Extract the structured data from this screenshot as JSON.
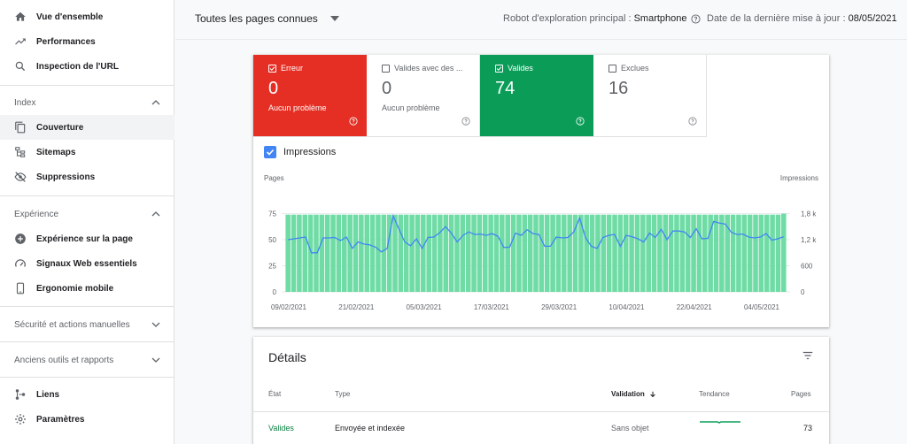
{
  "sidebar": {
    "items_top": [
      {
        "label": "Vue d'ensemble",
        "icon": "home-icon"
      },
      {
        "label": "Performances",
        "icon": "trending-up-icon"
      },
      {
        "label": "Inspection de l'URL",
        "icon": "search-icon"
      }
    ],
    "index_section": {
      "title": "Index",
      "items": [
        {
          "label": "Couverture",
          "icon": "copy-icon",
          "active": true
        },
        {
          "label": "Sitemaps",
          "icon": "sitemap-icon"
        },
        {
          "label": "Suppressions",
          "icon": "eye-off-icon"
        }
      ]
    },
    "experience_section": {
      "title": "Expérience",
      "items": [
        {
          "label": "Expérience sur la page",
          "icon": "add-circle-icon"
        },
        {
          "label": "Signaux Web essentiels",
          "icon": "speed-icon"
        },
        {
          "label": "Ergonomie mobile",
          "icon": "phone-icon"
        }
      ]
    },
    "security_section": {
      "title": "Sécurité et actions manuelles"
    },
    "legacy_section": {
      "title": "Anciens outils et rapports"
    },
    "items_bottom": [
      {
        "label": "Liens",
        "icon": "links-icon"
      },
      {
        "label": "Paramètres",
        "icon": "gear-icon"
      }
    ]
  },
  "topbar": {
    "page_select": "Toutes les pages connues",
    "robot_label": "Robot d'exploration principal :",
    "robot_value": "Smartphone",
    "last_update_label": "Date de la dernière mise à jour :",
    "last_update_value": "08/05/2021"
  },
  "summary": {
    "tiles": [
      {
        "label": "Erreur",
        "value": "0",
        "sub": "Aucun problème",
        "checked": true,
        "color": "#e52f24"
      },
      {
        "label": "Valides avec des ...",
        "value": "0",
        "sub": "Aucun problème",
        "checked": false,
        "color": "#ffffff"
      },
      {
        "label": "Valides",
        "value": "74",
        "sub": "",
        "checked": true,
        "color": "#0b9d58"
      },
      {
        "label": "Exclues",
        "value": "16",
        "sub": "",
        "checked": false,
        "color": "#ffffff"
      }
    ],
    "impressions_label": "Impressions"
  },
  "chart_data": {
    "type": "bar",
    "left_axis_label": "Pages",
    "right_axis_label": "Impressions",
    "left_ticks": [
      "0",
      "25",
      "50",
      "75"
    ],
    "right_ticks": [
      "0",
      "600",
      "1,2 k",
      "1,8 k"
    ],
    "x_tick_labels": [
      "09/02/2021",
      "21/02/2021",
      "05/03/2021",
      "17/03/2021",
      "29/03/2021",
      "10/04/2021",
      "22/04/2021",
      "04/05/2021"
    ],
    "ylim_left": [
      0,
      100
    ],
    "ylim_right": [
      0,
      1800
    ],
    "bar_color": "#6fdca5",
    "line_color": "#4285f4",
    "series": [
      {
        "name": "Valides",
        "values": [
          74,
          74,
          74,
          74,
          74,
          74,
          74,
          74,
          74,
          74,
          74,
          74,
          74,
          74,
          74,
          74,
          74,
          74,
          74,
          74,
          74,
          74,
          74,
          74,
          74,
          74,
          74,
          74,
          74,
          74,
          74,
          74,
          74,
          74,
          74,
          74,
          74,
          74,
          74,
          74,
          74,
          74,
          74,
          74,
          74,
          74,
          74,
          74,
          74,
          74,
          74,
          74,
          74,
          74,
          74,
          74,
          74,
          74,
          74,
          74,
          74,
          74,
          74,
          74,
          74,
          74,
          74,
          74,
          74,
          74,
          74,
          74,
          74,
          74,
          74,
          74,
          74,
          74,
          74,
          74,
          74,
          74,
          74,
          74,
          74,
          74,
          74,
          74,
          75
        ]
      },
      {
        "name": "Impressions",
        "values": [
          1200,
          1220,
          1240,
          1260,
          900,
          900,
          1240,
          1240,
          1250,
          1180,
          1260,
          1000,
          1150,
          1100,
          1080,
          1030,
          920,
          1000,
          1750,
          1450,
          1150,
          1060,
          1220,
          1000,
          1250,
          1260,
          1360,
          1500,
          1350,
          1150,
          1300,
          1380,
          1320,
          1330,
          1300,
          1340,
          1280,
          1020,
          1030,
          1350,
          1300,
          1430,
          1340,
          1320,
          1050,
          1050,
          1260,
          1240,
          1250,
          1380,
          1700,
          1250,
          1050,
          1000,
          1250,
          1300,
          1320,
          1050,
          1300,
          1270,
          1220,
          1150,
          1350,
          1250,
          1440,
          1200,
          1400,
          1400,
          1380,
          1250,
          1450,
          1220,
          1230,
          1620,
          1580,
          1560,
          1370,
          1320,
          1330,
          1260,
          1240,
          1260,
          1340,
          1190,
          1220,
          1270
        ]
      }
    ]
  },
  "details": {
    "title": "Détails",
    "columns": {
      "etat": "État",
      "type": "Type",
      "validation": "Validation",
      "tendance": "Tendance",
      "pages": "Pages"
    },
    "row": {
      "etat": "Valides",
      "type": "Envoyée et indexée",
      "validation": "Sans objet",
      "pages": "73"
    }
  }
}
